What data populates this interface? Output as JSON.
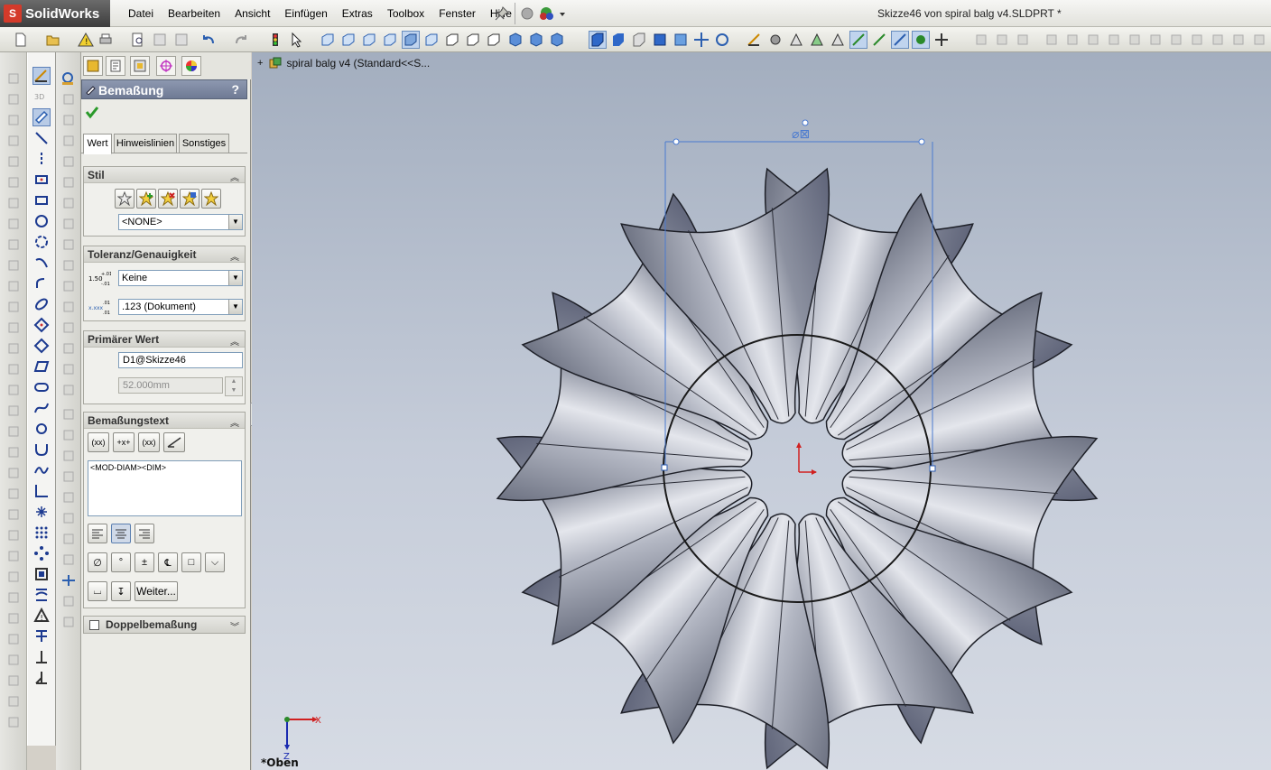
{
  "app": {
    "logo_text": "SolidWorks",
    "logo_mark": "S"
  },
  "menu": [
    "Datei",
    "Bearbeiten",
    "Ansicht",
    "Einfügen",
    "Extras",
    "Toolbox",
    "Fenster",
    "Hilfe"
  ],
  "document_title": "Skizze46 von spiral balg v4.SLDPRT *",
  "tree": {
    "item": "spiral balg v4  (Standard<<S..."
  },
  "pm": {
    "title": "Bemaßung",
    "help": "?",
    "tabs": [
      "Wert",
      "Hinweislinien",
      "Sonstiges"
    ],
    "style": {
      "header": "Stil",
      "select": "<NONE>"
    },
    "tolerance": {
      "header": "Toleranz/Genauigkeit",
      "tolerance_value": "Keine",
      "precision_value": ".123 (Dokument)",
      "tol_icon_text": "1.50",
      "prec_icon_text": "x.xxx"
    },
    "primary": {
      "header": "Primärer Wert",
      "name": "D1@Skizze46",
      "value": "52.000mm"
    },
    "dimtext": {
      "header": "Bemaßungstext",
      "btn1": "(xx)",
      "btn2": "+x+",
      "btn3": "(xx)",
      "content": "<MOD-DIAM><DIM>"
    },
    "symbols": {
      "more": "Weiter..."
    },
    "dual": {
      "label": "Doppelbemaßung"
    }
  },
  "viewport": {
    "view_name": "*Oben",
    "triad_x": "X",
    "triad_z": "Z"
  },
  "colors": {
    "accent": "#6f7a94",
    "sketch": "#3a6fd0",
    "model": "#7a7f8e",
    "background": "#b6bfce"
  }
}
